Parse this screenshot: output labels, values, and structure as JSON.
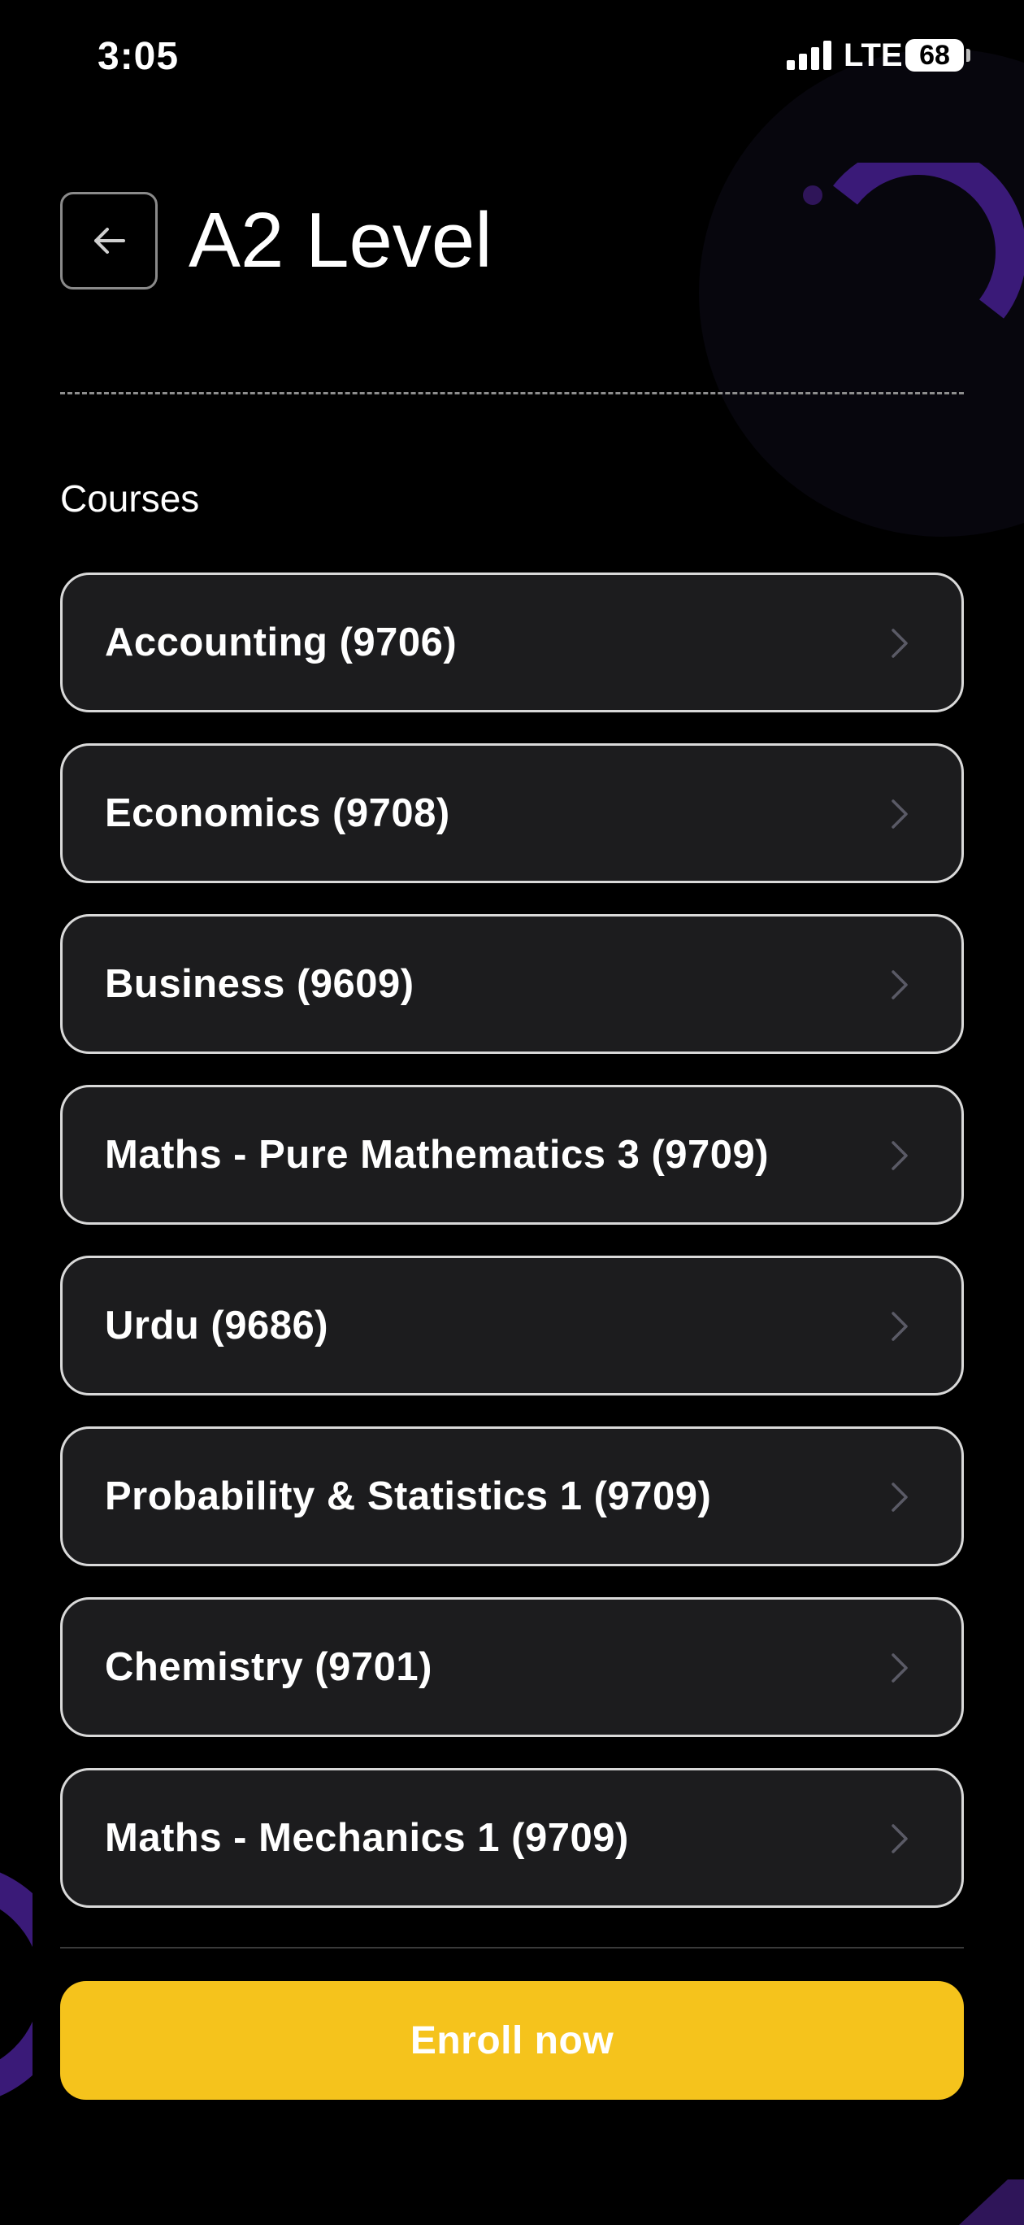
{
  "status_bar": {
    "time": "3:05",
    "network": "LTE",
    "battery": "68"
  },
  "header": {
    "title": "A2 Level",
    "back_icon": "arrow-left-icon"
  },
  "section": {
    "label": "Courses"
  },
  "courses": [
    {
      "label": "Accounting (9706)"
    },
    {
      "label": "Economics (9708)"
    },
    {
      "label": "Business (9609)"
    },
    {
      "label": "Maths - Pure Mathematics 3 (9709)"
    },
    {
      "label": "Urdu (9686)"
    },
    {
      "label": "Probability & Statistics 1 (9709)"
    },
    {
      "label": "Chemistry (9701)"
    },
    {
      "label": "Maths - Mechanics 1 (9709)"
    }
  ],
  "enroll": {
    "label": "Enroll now"
  },
  "colors": {
    "background": "#000000",
    "card_background": "#1c1c1e",
    "card_border": "#d9d9d9",
    "accent": "#f5c31c",
    "decor_purple": "#3a1a78"
  }
}
